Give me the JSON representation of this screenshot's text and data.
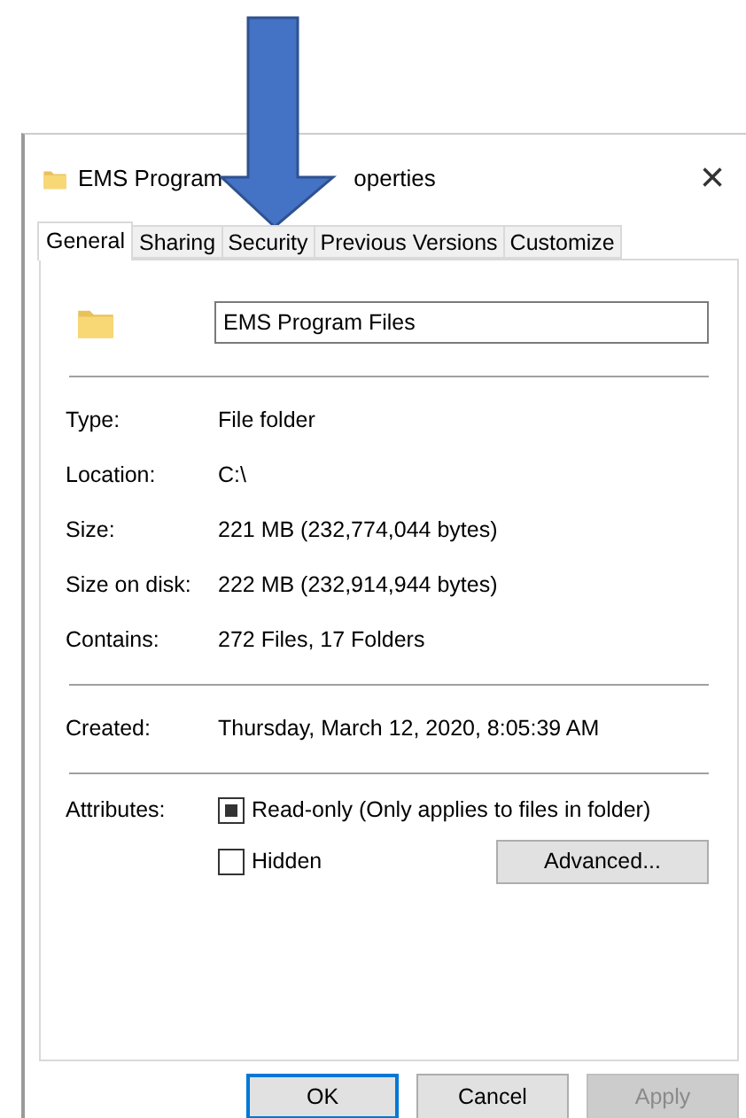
{
  "window": {
    "title_start": "EMS Program",
    "title_end": "operties",
    "close": "×"
  },
  "tabs": [
    {
      "label": "General",
      "selected": true
    },
    {
      "label": "Sharing",
      "selected": false
    },
    {
      "label": "Security",
      "selected": false
    },
    {
      "label": "Previous Versions",
      "selected": false
    },
    {
      "label": "Customize",
      "selected": false
    }
  ],
  "name_field": {
    "value": "EMS Program Files"
  },
  "groups": [
    [
      {
        "label": "Type:",
        "value": "File folder"
      },
      {
        "label": "Location:",
        "value": "C:\\"
      },
      {
        "label": "Size:",
        "value": "221 MB (232,774,044 bytes)"
      },
      {
        "label": "Size on disk:",
        "value": "222 MB (232,914,944 bytes)"
      },
      {
        "label": "Contains:",
        "value": "272 Files, 17 Folders"
      }
    ],
    [
      {
        "label": "Created:",
        "value": "Thursday, March 12, 2020, 8:05:39 AM"
      }
    ]
  ],
  "attributes": {
    "label": "Attributes:",
    "items": [
      {
        "label": "Read-only (Only applies to files in folder)",
        "checked": true
      },
      {
        "label": "Hidden",
        "checked": false
      }
    ],
    "advanced": "Advanced..."
  },
  "buttons": [
    {
      "label": "OK",
      "default": true,
      "disabled": false
    },
    {
      "label": "Cancel",
      "default": false,
      "disabled": false
    },
    {
      "label": "Apply",
      "default": false,
      "disabled": true
    }
  ]
}
